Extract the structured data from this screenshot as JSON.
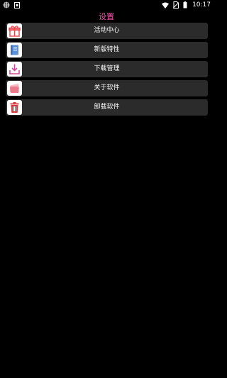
{
  "status_bar": {
    "left_icons": [
      "bug-notification-icon",
      "android-download-icon"
    ],
    "right_icons": [
      "wifi-icon",
      "no-sim-icon",
      "battery-icon"
    ],
    "time": "10:17"
  },
  "header": {
    "title": "设置"
  },
  "menu": {
    "items": [
      {
        "label": "活动中心",
        "icon": "gift-icon"
      },
      {
        "label": "新版特性",
        "icon": "book-icon"
      },
      {
        "label": "下载管理",
        "icon": "download-icon"
      },
      {
        "label": "关于软件",
        "icon": "cards-icon"
      },
      {
        "label": "卸载软件",
        "icon": "trash-icon"
      }
    ]
  },
  "colors": {
    "background": "#000000",
    "title": "#f050a8",
    "item_background": "#2b2b2b",
    "icon_tile": "#ffffff",
    "accent_red": "#e8474c",
    "accent_blue": "#5b8fd6",
    "accent_pink": "#d4479a"
  }
}
